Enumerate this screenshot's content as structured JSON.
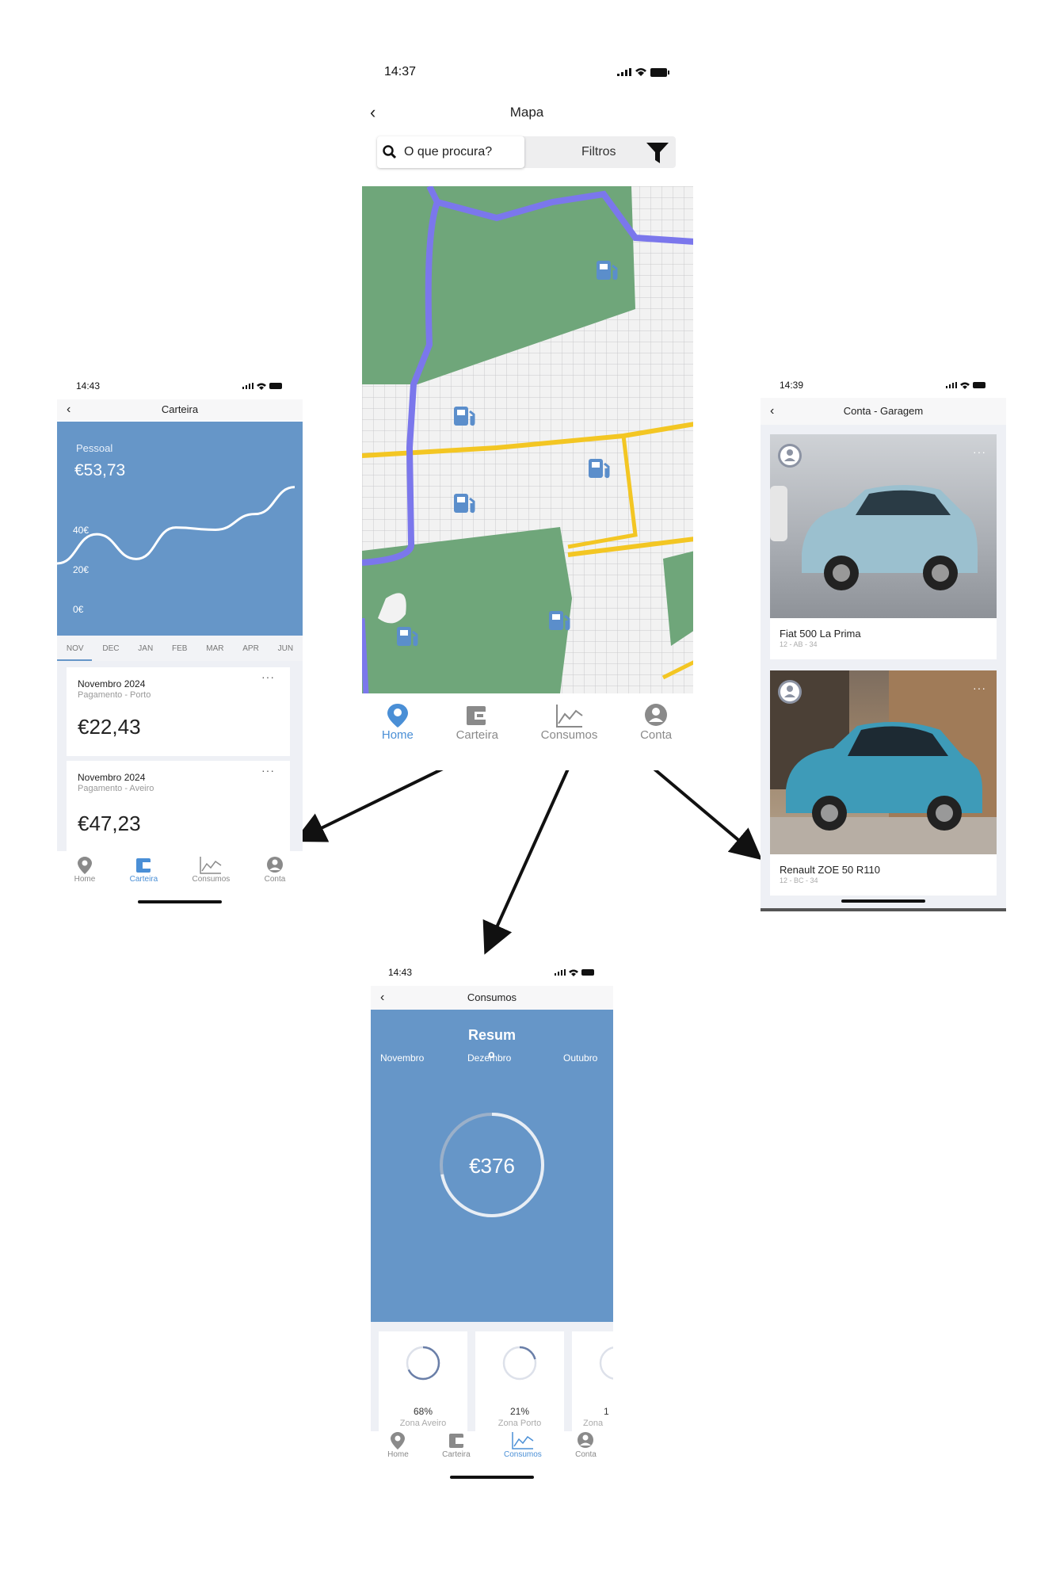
{
  "colors": {
    "accent": "#4a8fd6",
    "panel": "#6696c8",
    "park": "#6fa67a",
    "road_main": "#7b77ec",
    "road_yellow": "#f3c623",
    "map_bg": "#f2f2f2"
  },
  "map_screen": {
    "time": "14:37",
    "title": "Mapa",
    "search_placeholder": "O que procura?",
    "filter_label": "Filtros",
    "icons": {
      "back": "chevron-left-icon",
      "search": "search-icon",
      "filter": "filter-icon",
      "station": "charging-station-icon"
    }
  },
  "tabs": [
    {
      "label": "Home",
      "icon": "map-pin-icon"
    },
    {
      "label": "Carteira",
      "icon": "wallet-icon"
    },
    {
      "label": "Consumos",
      "icon": "chart-icon"
    },
    {
      "label": "Conta",
      "icon": "user-icon"
    }
  ],
  "wallet_screen": {
    "time": "14:43",
    "title": "Carteira",
    "account_label": "Pessoal",
    "balance": "€53,73",
    "y_labels": [
      "40€",
      "20€",
      "0€"
    ],
    "months": [
      "NOV",
      "DEC",
      "JAN",
      "FEB",
      "MAR",
      "APR",
      "JUN"
    ],
    "chart_data": {
      "type": "line",
      "categories": [
        "NOV",
        "DEC",
        "JAN",
        "FEB",
        "MAR",
        "APR",
        "JUN"
      ],
      "values": [
        18,
        31,
        20,
        34,
        33,
        40,
        52
      ],
      "ylim": [
        0,
        60
      ]
    },
    "entries": [
      {
        "month": "Novembro 2024",
        "description": "Pagamento - Porto",
        "amount": "€22,43"
      },
      {
        "month": "Novembro 2024",
        "description": "Pagamento - Aveiro",
        "amount": "€47,23"
      }
    ]
  },
  "garage_screen": {
    "time": "14:39",
    "title": "Conta - Garagem",
    "cars": [
      {
        "name": "Fiat 500 La Prima",
        "plate": "12 - AB - 34"
      },
      {
        "name": "Renault ZOE 50 R110",
        "plate": "12 - BC - 34"
      }
    ]
  },
  "consumption_screen": {
    "time": "14:43",
    "title": "Consumos",
    "section_title": "Resum",
    "section_title_overlap": "o",
    "months": [
      "Novembro",
      "Dezembro",
      "Outubro"
    ],
    "total": "€376",
    "total_progress": 0.28,
    "zones": [
      {
        "percent": "68%",
        "label": "Zona Aveiro",
        "progress": 0.68
      },
      {
        "percent": "21%",
        "label": "Zona Porto",
        "progress": 0.21
      },
      {
        "percent": "1",
        "label": "Zona",
        "progress": 0.1
      }
    ]
  }
}
